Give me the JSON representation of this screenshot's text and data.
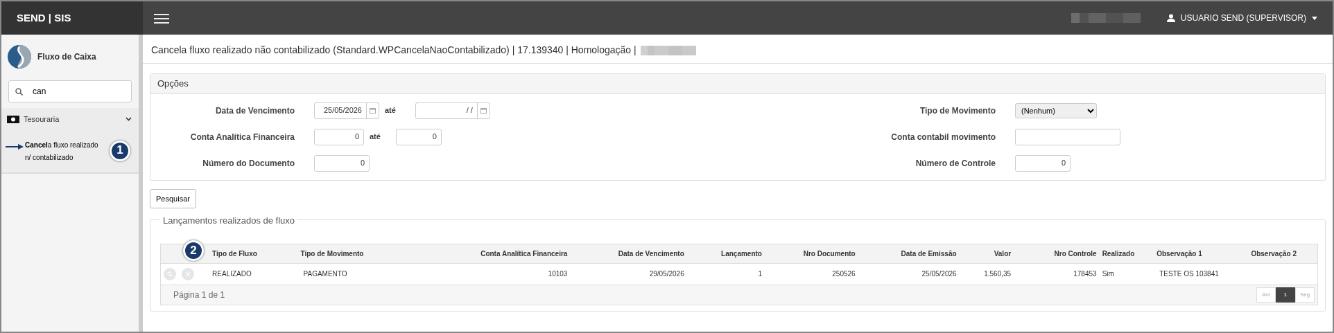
{
  "brand": "SEND | SIS",
  "user": {
    "label": "USUARIO SEND (SUPERVISOR)"
  },
  "sidebar": {
    "module": "Fluxo de Caixa",
    "search": {
      "value": "can"
    },
    "groups": [
      {
        "label": "Tesouraria",
        "expanded": true,
        "items": [
          {
            "label": "**Cancel**a fluxo realizado n/ contabilizado",
            "selected": true,
            "callout": "1"
          }
        ]
      }
    ]
  },
  "page_title": "Cancela fluxo realizado não contabilizado (Standard.WPCancelaNaoContabilizado) | 17.139340 | Homologação |",
  "options": {
    "title": "Opções",
    "left": [
      {
        "label": "Data de Vencimento",
        "kind": "date-range",
        "from": "25/05/2026",
        "sep": "até",
        "to": " /  /"
      },
      {
        "label": "Conta Analítica Financeira",
        "kind": "number-range",
        "from": "0",
        "sep": "até",
        "to": "0"
      },
      {
        "label": "Número do Documento",
        "kind": "number",
        "value": "0"
      }
    ],
    "right": [
      {
        "label": "Tipo de Movimento",
        "kind": "select",
        "value": "(Nenhum)"
      },
      {
        "label": "Conta contabil movimento",
        "kind": "text"
      },
      {
        "label": "Número de Controle",
        "kind": "number",
        "value": "0"
      }
    ]
  },
  "search_button": "Pesquisar",
  "results": {
    "legend": "Lançamentos realizados de fluxo",
    "callout": "2",
    "columns": [
      "Tipo de Fluxo",
      "Tipo de Movimento",
      "Conta Analítica Financeira",
      "Data de Vencimento",
      "Lançamento",
      "Nro Documento",
      "Data de Emissão",
      "Valor",
      "Nro Controle",
      "Realizado",
      "Observação 1",
      "Observação 2"
    ],
    "rows": [
      {
        "cells": [
          "REALIZADO",
          "PAGAMENTO",
          "10103",
          "29/05/2026",
          "1",
          "250526",
          "25/05/2026",
          "1.560,35",
          "178453",
          "Sim",
          "TESTE OS 103841",
          ""
        ]
      }
    ],
    "page_info": "Página 1 de 1",
    "pager": [
      {
        "label": "Ant",
        "disabled": true,
        "selected": false
      },
      {
        "label": "1",
        "disabled": false,
        "selected": true
      },
      {
        "label": "Seg",
        "disabled": true,
        "selected": false
      }
    ]
  }
}
